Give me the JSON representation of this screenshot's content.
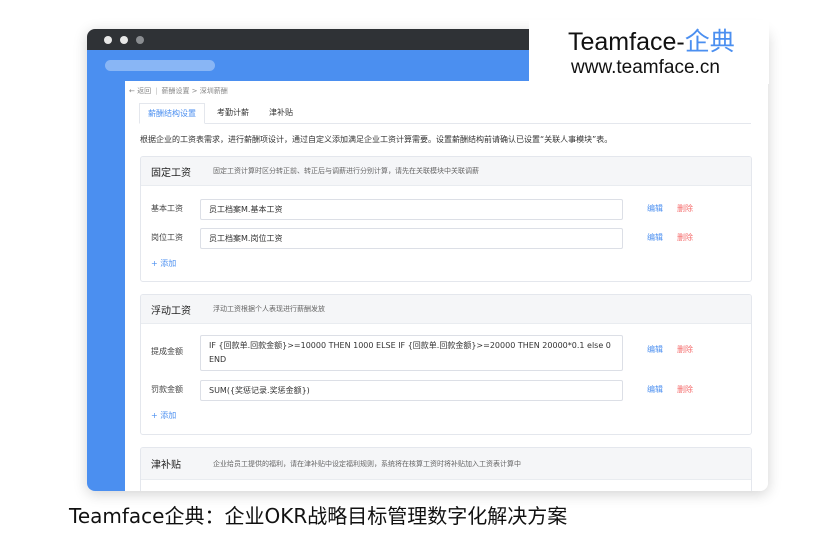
{
  "breadcrumb": {
    "back": "← 返回",
    "path": "薪酬设置 > 深圳薪酬"
  },
  "tabs": [
    "薪酬结构设置",
    "考勤计薪",
    "津补贴"
  ],
  "description": "根据企业的工资表需求，进行薪酬项设计，通过自定义添加满足企业工资计算需要。设置薪酬结构前请确认已设置“关联人事模块”表。",
  "sections": {
    "fixed": {
      "title": "固定工资",
      "note": "固定工资计算时区分转正前、转正后与调薪进行分别计算，请先在关联模块中关联调薪",
      "rows": [
        {
          "label": "基本工资",
          "value": "员工档案M.基本工资",
          "edit": "编辑",
          "delete": "删除"
        },
        {
          "label": "岗位工资",
          "value": "员工档案M.岗位工资",
          "edit": "编辑",
          "delete": "删除"
        }
      ],
      "add": "+ 添加"
    },
    "float": {
      "title": "浮动工资",
      "note": "浮动工资根据个人表现进行薪酬发放",
      "rows": [
        {
          "label": "提成金额",
          "value_line1": "IF {回款单.回款金额}>=10000 THEN 1000 ELSE IF {回款单.回款金额}>=20000 THEN 20000*0.1 else 0",
          "value_line2": "END",
          "edit": "编辑",
          "delete": "删除"
        },
        {
          "label": "罚款金额",
          "value": "SUM({奖惩记录.奖惩金额})",
          "edit": "编辑",
          "delete": "删除"
        }
      ],
      "add": "+ 添加"
    },
    "allowance": {
      "title": "津补贴",
      "note": "企业给员工提供的福利，请在津补贴中设定福利规则，系统将在核算工资时将补贴加入工资表计算中"
    }
  },
  "watermark": {
    "brand_en": "Teamface-",
    "brand_cn": "企典",
    "url": "www.teamface.cn"
  },
  "caption": "Teamface企典：企业OKR战略目标管理数字化解决方案",
  "colors": {
    "accent": "#4b8ff0",
    "danger": "#f56c6c",
    "titlebar": "#2f3236"
  }
}
